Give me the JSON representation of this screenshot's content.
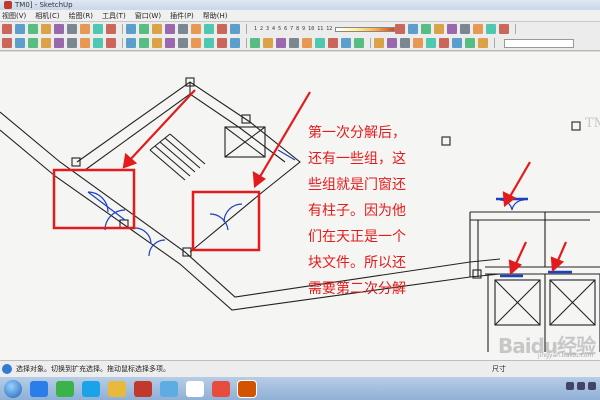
{
  "window": {
    "title": "TM0] - SketchUp"
  },
  "menubar": {
    "items": [
      "视图(V)",
      "相机(C)",
      "绘图(R)",
      "工具(T)",
      "窗口(W)",
      "插件(P)",
      "帮助(H)"
    ]
  },
  "toolbar": {
    "shadow_scale_numbers": "1 2 3 4 5 6 7 8 9 10 11 12",
    "tools_row1": [
      "select-tool",
      "eraser-tool",
      "paint-tool",
      "line-tool",
      "arc-tool",
      "rectangle-tool",
      "circle-tool",
      "polygon-tool",
      "freehand-tool",
      "move-tool",
      "pushpull-tool",
      "rotate-tool",
      "followme-tool",
      "scale-tool",
      "offset-tool",
      "tape-tool",
      "dimension-tool",
      "protractor-tool",
      "text-tool",
      "axes-tool",
      "3dtext-tool",
      "orbit-tool",
      "pan-tool",
      "zoom-tool",
      "zoom-window-tool",
      "zoom-extents-tool",
      "previous-view-tool"
    ],
    "tools_row2": [
      "new-icon",
      "open-icon",
      "save-icon",
      "cut-icon",
      "copy-icon",
      "paste-icon",
      "erase-icon",
      "undo-icon",
      "redo-icon",
      "print-icon",
      "model-info-icon",
      "iso-view-icon",
      "top-view-icon",
      "front-view-icon",
      "right-view-icon",
      "back-view-icon",
      "left-view-icon",
      "xray-icon",
      "wireframe-icon",
      "hidden-line-icon",
      "shaded-icon",
      "textured-icon",
      "monochrome-icon",
      "section-plane-icon",
      "section-display-icon",
      "section-cut-icon",
      "component-icon",
      "group-icon",
      "layer-icon",
      "outliner-icon",
      "sandbox-icon",
      "shadow-settings-icon",
      "fog-icon",
      "camera-icon",
      "walk-icon",
      "lookaround-icon",
      "position-camera-icon",
      "styles-icon",
      "scenes-icon",
      "photo-match-icon",
      "tray-icon"
    ]
  },
  "annotation": {
    "lines": [
      "第一次分解后，",
      "还有一些组，这",
      "些组就是门窗还",
      "有柱子。因为他",
      "们在天正是一个",
      "块文件。所以还",
      "需要第二次分解"
    ]
  },
  "viewport": {
    "watermark": "TM"
  },
  "status": {
    "text": "选择对象。切换到扩充选择。拖动鼠标选择多项。",
    "measure_label": "尺寸"
  },
  "watermark": {
    "logo": "Baidu经验",
    "sub": "jingyan.baidu.com"
  },
  "taskbar": {
    "tasks": [
      "ie-icon",
      "360-icon",
      "qq-icon",
      "folder-icon",
      "sketchup-icon",
      "image-viewer-icon",
      "app-icon",
      "fireworks-icon",
      "powerpoint-icon"
    ]
  },
  "colors": {
    "annotation": "#e21c1c",
    "wall_line": "#222222",
    "door_window": "#1f3fbf",
    "background": "#f5f5f3"
  }
}
